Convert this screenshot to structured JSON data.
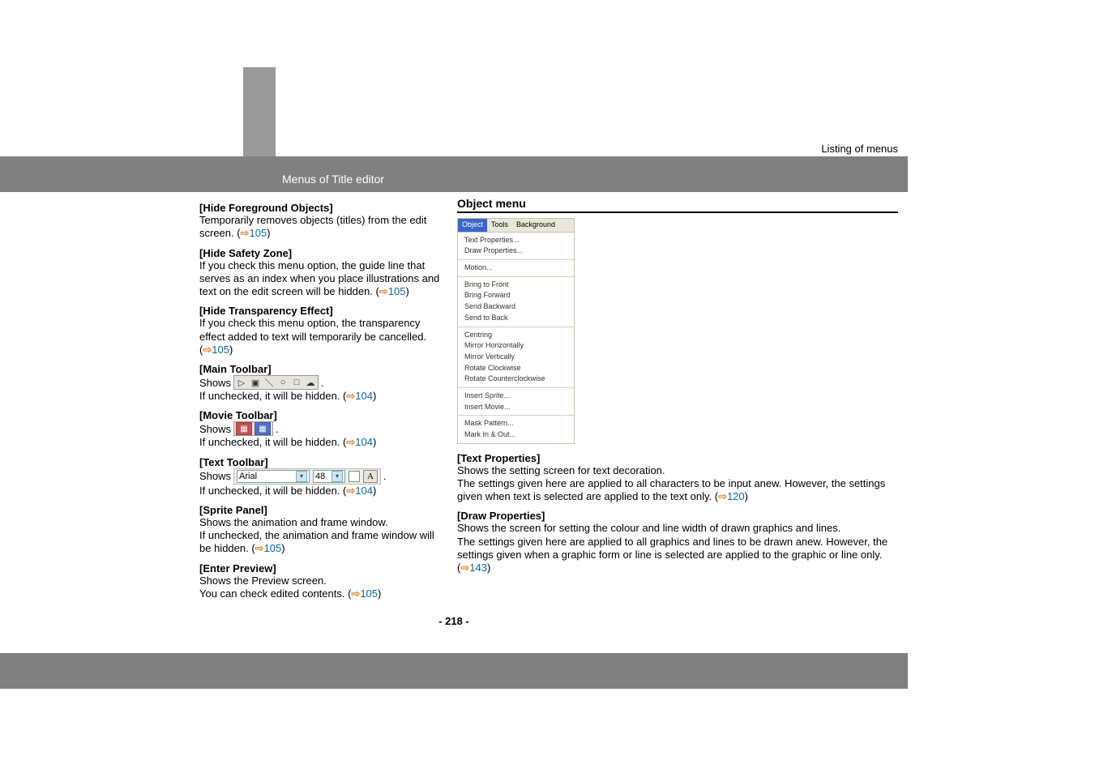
{
  "header": {
    "listing": "Listing of menus"
  },
  "banner": {
    "title": "Menus of Title editor"
  },
  "left": {
    "hideForeground": {
      "title": "[Hide Foreground Objects]",
      "body": "Temporarily removes objects (titles) from the edit screen. (",
      "ref": "105",
      "after": ")"
    },
    "hideSafety": {
      "title": "[Hide Safety Zone]",
      "body1": "If you check this menu option, the guide line that serves as an index when you place illustrations and text on the edit screen will be hidden. (",
      "ref": "105",
      "after": ")"
    },
    "hideTransparency": {
      "title": "[Hide Transparency Effect]",
      "body1": "If you check this menu option, the transparency effect added to text will temporarily be cancelled. (",
      "ref": "105",
      "after": ")"
    },
    "mainToolbar": {
      "title": "[Main Toolbar]",
      "showsLabel": "Shows",
      "unchecked": "If unchecked, it will be hidden. (",
      "ref": "104",
      "after": ")"
    },
    "movieToolbar": {
      "title": "[Movie Toolbar]",
      "showsLabel": "Shows",
      "unchecked": "If unchecked, it will be hidden. (",
      "ref": "104",
      "after": ")"
    },
    "textToolbar": {
      "title": "[Text Toolbar]",
      "showsLabel": "Shows",
      "font": "Arial",
      "size": "48",
      "unchecked": "If unchecked, it will be hidden. (",
      "ref": "104",
      "after": ")"
    },
    "spritePanel": {
      "title": "[Sprite Panel]",
      "l1": "Shows the animation and frame window.",
      "l2a": "If unchecked, the animation and frame window will be hidden. (",
      "ref": "105",
      "after": ")"
    },
    "enterPreview": {
      "title": "[Enter Preview]",
      "l1": "Shows the Preview screen.",
      "l2a": "You can check edited contents. (",
      "ref": "105",
      "after": ")"
    }
  },
  "right": {
    "objectMenu": {
      "title": "Object menu"
    },
    "menu": {
      "tabs": {
        "object": "Object",
        "tools": "Tools",
        "background": "Background"
      },
      "g1": {
        "a": "Text Properties...",
        "b": "Draw Properties..."
      },
      "g2": {
        "a": "Motion..."
      },
      "g3": {
        "a": "Bring to Front",
        "b": "Bring Forward",
        "c": "Send Backward",
        "d": "Send to Back"
      },
      "g4": {
        "a": "Centring",
        "b": "Mirror Horizontally",
        "c": "Mirror Vertically",
        "d": "Rotate Clockwise",
        "e": "Rotate Counterclockwise"
      },
      "g5": {
        "a": "Insert Sprite...",
        "b": "Insert Movie..."
      },
      "g6": {
        "a": "Mask Pattern...",
        "b": "Mark In & Out..."
      }
    },
    "textProps": {
      "title": "[Text Properties]",
      "l1": "Shows the setting screen for text decoration.",
      "l2a": "The settings given here are applied to all characters to be input anew. However, the settings given when text is selected are applied to the text only. (",
      "ref": "120",
      "after": ")"
    },
    "drawProps": {
      "title": "[Draw Properties]",
      "l1": "Shows the screen for setting the colour and line width of drawn graphics and lines.",
      "l2a": "The settings given here are applied to all graphics and lines to be drawn anew. However, the settings given when a graphic form or line is selected are applied to the graphic or line only. (",
      "ref": "143",
      "after": ")"
    }
  },
  "pagenum": "- 218 -"
}
